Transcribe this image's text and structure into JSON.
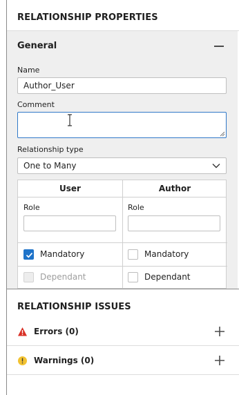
{
  "properties_panel": {
    "title": "RELATIONSHIP PROPERTIES",
    "general": {
      "title": "General",
      "name_label": "Name",
      "name_value": "Author_User",
      "comment_label": "Comment",
      "comment_value": "",
      "type_label": "Relationship type",
      "type_value": "One to Many"
    },
    "table": {
      "columns": [
        {
          "header": "User",
          "role_label": "Role",
          "role_value": "",
          "mandatory_label": "Mandatory",
          "mandatory_checked": true,
          "dependant_label": "Dependant",
          "dependant_checked": false,
          "dependant_disabled": true
        },
        {
          "header": "Author",
          "role_label": "Role",
          "role_value": "",
          "mandatory_label": "Mandatory",
          "mandatory_checked": false,
          "dependant_label": "Dependant",
          "dependant_checked": false,
          "dependant_disabled": false
        }
      ]
    }
  },
  "issues_panel": {
    "title": "RELATIONSHIP ISSUES",
    "errors_label": "Errors (0)",
    "warnings_label": "Warnings (0)"
  },
  "colors": {
    "accent": "#1e73c9",
    "error": "#d93025",
    "warning": "#f2c231"
  }
}
